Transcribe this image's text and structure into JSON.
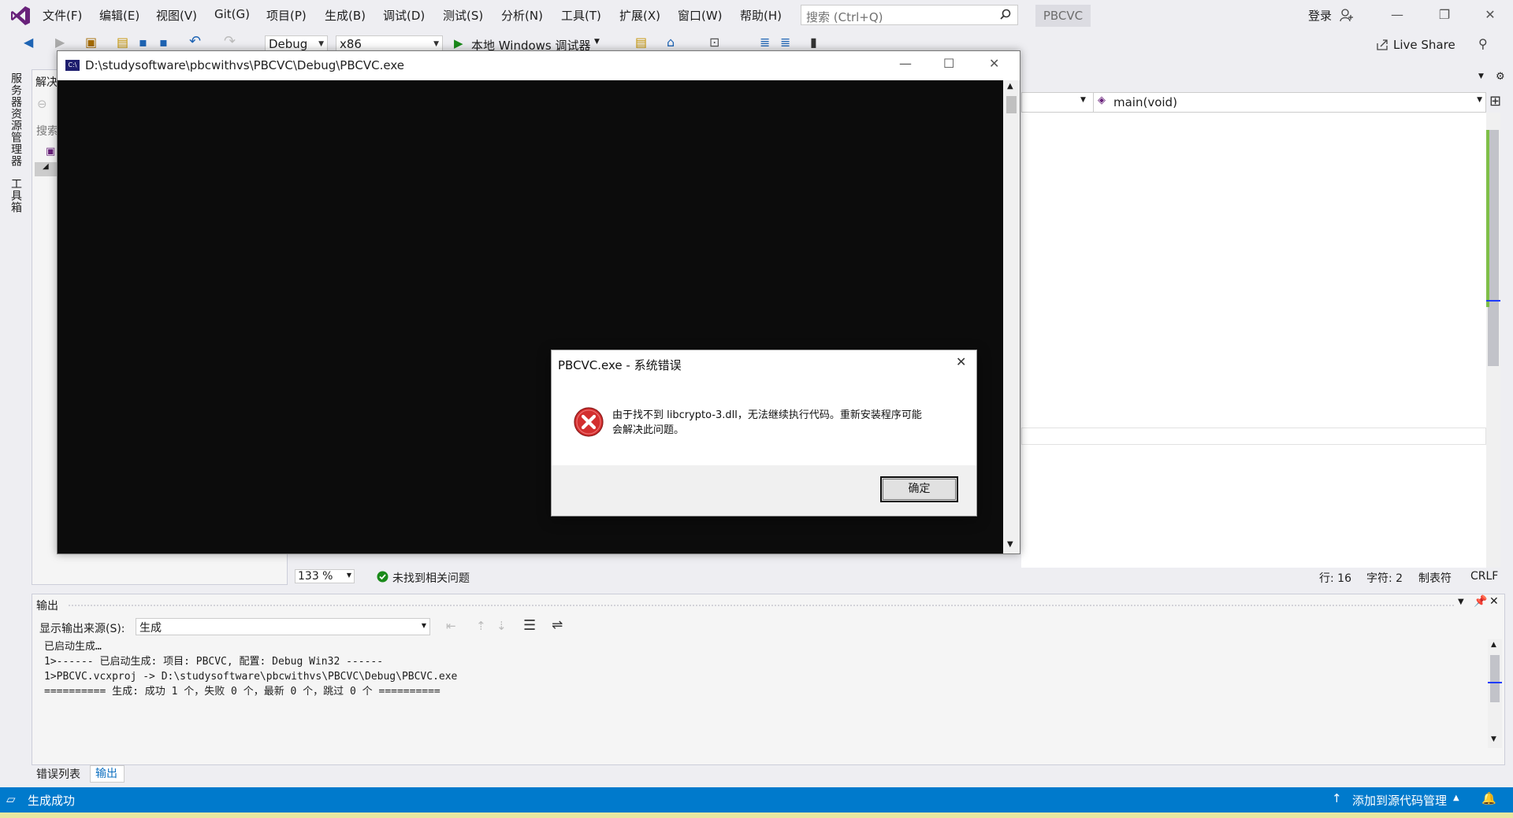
{
  "menu": {
    "file": "文件(F)",
    "edit": "编辑(E)",
    "view": "视图(V)",
    "git": "Git(G)",
    "project": "项目(P)",
    "build": "生成(B)",
    "debug": "调试(D)",
    "test": "测试(S)",
    "analyze": "分析(N)",
    "tools": "工具(T)",
    "extensions": "扩展(X)",
    "window": "窗口(W)",
    "help": "帮助(H)"
  },
  "search": {
    "placeholder": "搜索 (Ctrl+Q)"
  },
  "project_name": "PBCVC",
  "login_label": "登录",
  "toolbar": {
    "config": "Debug",
    "platform": "x86",
    "run_label": "本地 Windows 调试器",
    "live_share": "Live Share"
  },
  "left_tabs": {
    "server_explorer": "服务器资源管理器",
    "toolbox": "工具箱"
  },
  "solution_explorer": {
    "title": "解决",
    "search": "搜索"
  },
  "editor": {
    "member_dropdown": "main(void)",
    "zoom": "133 %",
    "issues": "未找到相关问题",
    "line": "行: 16",
    "col": "字符: 2",
    "tabs": "制表符",
    "eol": "CRLF"
  },
  "console": {
    "title": "D:\\studysoftware\\pbcwithvs\\PBCVC\\Debug\\PBCVC.exe"
  },
  "dialog": {
    "title": "PBCVC.exe - 系统错误",
    "message_line1": "由于找不到 libcrypto-3.dll，无法继续执行代码。重新安装程序可能",
    "message_line2": "会解决此问题。",
    "ok": "确定"
  },
  "output": {
    "title": "输出",
    "source_label": "显示输出来源(S):",
    "source_value": "生成",
    "lines": [
      "已启动生成…",
      "1>------ 已启动生成: 项目: PBCVC, 配置: Debug Win32 ------",
      "1>PBCVC.vcxproj -> D:\\studysoftware\\pbcwithvs\\PBCVC\\Debug\\PBCVC.exe",
      "========== 生成: 成功 1 个，失败 0 个，最新 0 个，跳过 0 个 =========="
    ]
  },
  "bottom_tabs": {
    "errors": "错误列表",
    "output": "输出"
  },
  "status": {
    "build_state": "生成成功",
    "source_control": "添加到源代码管理"
  },
  "colors": {
    "status_bar": "#007acc",
    "console_bg": "#0c0c0c",
    "error_icon": "#d32f2f"
  }
}
